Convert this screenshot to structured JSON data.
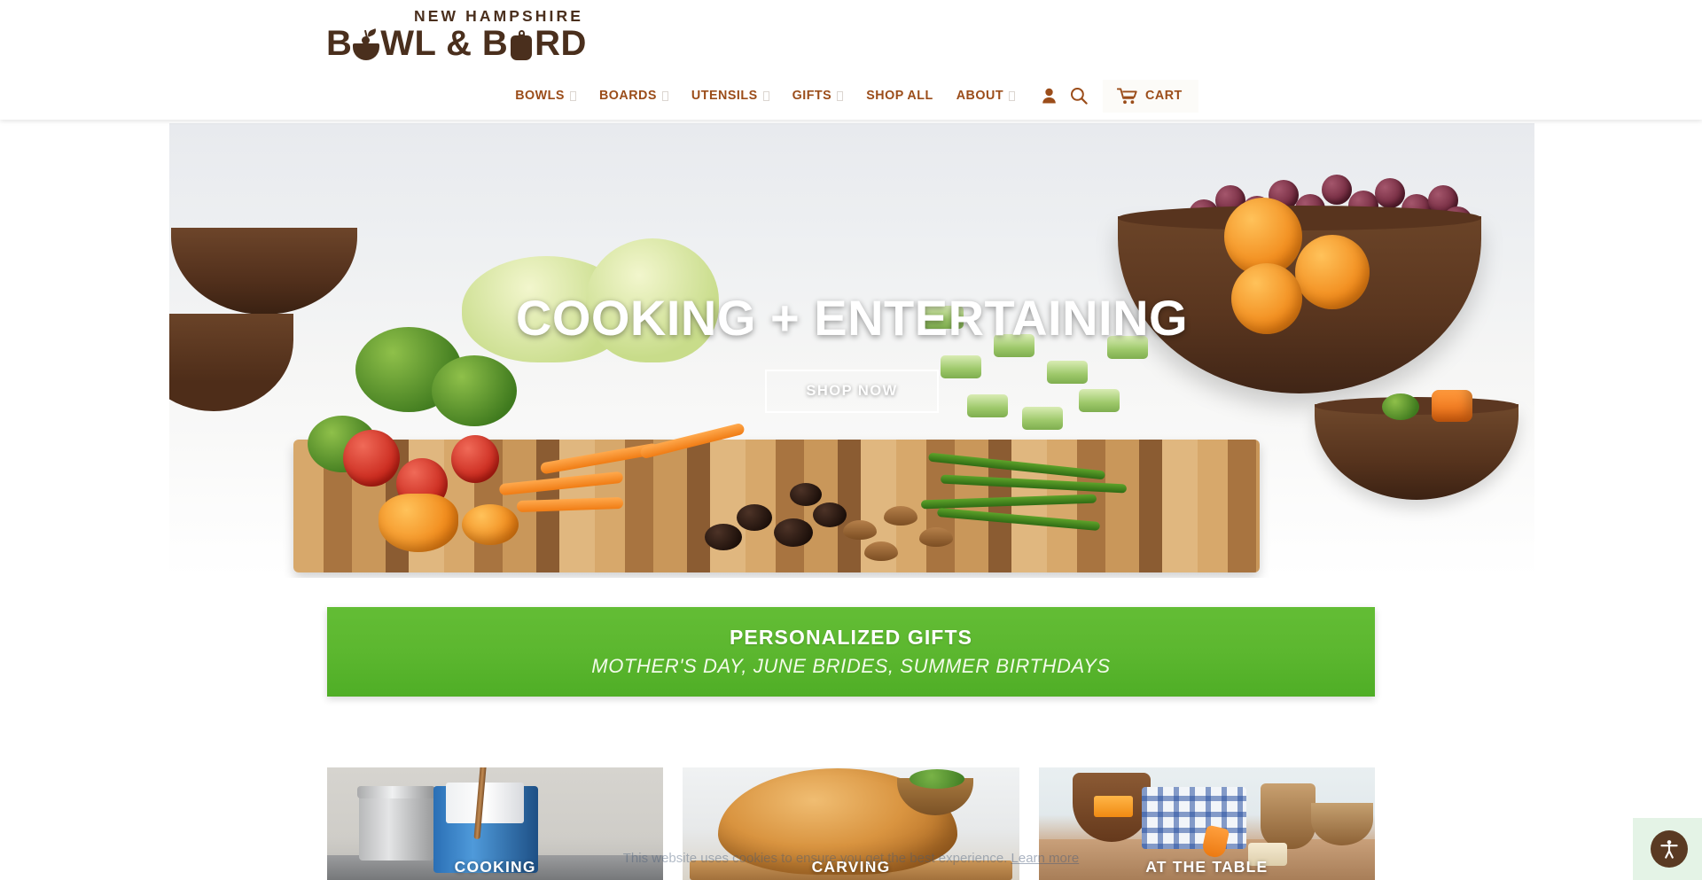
{
  "brand": {
    "tagline": "NEW HAMPSHIRE",
    "name_part1": "B",
    "name_part2": "WL & B",
    "name_part3": "RD",
    "bowl_icon": "bowl-icon",
    "board_icon": "cutting-board-icon"
  },
  "nav": {
    "items": [
      {
        "label": "BOWLS",
        "has_dropdown": true
      },
      {
        "label": "BOARDS",
        "has_dropdown": true
      },
      {
        "label": "UTENSILS",
        "has_dropdown": true
      },
      {
        "label": "GIFTS",
        "has_dropdown": true
      },
      {
        "label": "SHOP ALL",
        "has_dropdown": false
      },
      {
        "label": "ABOUT",
        "has_dropdown": true
      }
    ],
    "account_icon": "user-account-icon",
    "search_icon": "search-icon",
    "cart_icon": "shopping-cart-icon",
    "cart_label": "CART"
  },
  "hero": {
    "title": "COOKING + ENTERTAINING",
    "button_label": "SHOP NOW",
    "image_alt": "cutting board with fresh vegetables and wooden bowls of fruit"
  },
  "promo": {
    "title": "PERSONALIZED GIFTS",
    "subtitle": "MOTHER'S DAY, JUNE BRIDES, SUMMER BIRTHDAYS"
  },
  "categories": [
    {
      "label": "COOKING",
      "image_alt": "stainless and blue stock pots on a stove with wooden spoon"
    },
    {
      "label": "CARVING",
      "image_alt": "roasted turkey on a wooden carving board"
    },
    {
      "label": "AT THE TABLE",
      "image_alt": "wooden bowls, blue checked linen and butter on a wooden table"
    }
  ],
  "cookie_notice": {
    "text": "This website uses cookies to ensure you get the best experience.",
    "link_label": "Learn more"
  },
  "accessibility": {
    "icon": "accessibility-person-icon",
    "label": "Accessibility options"
  },
  "colors": {
    "brand_brown": "#4a2f1d",
    "nav_rust": "#9b4d1a",
    "promo_green": "#5cb72f",
    "page_white": "#ffffff"
  }
}
